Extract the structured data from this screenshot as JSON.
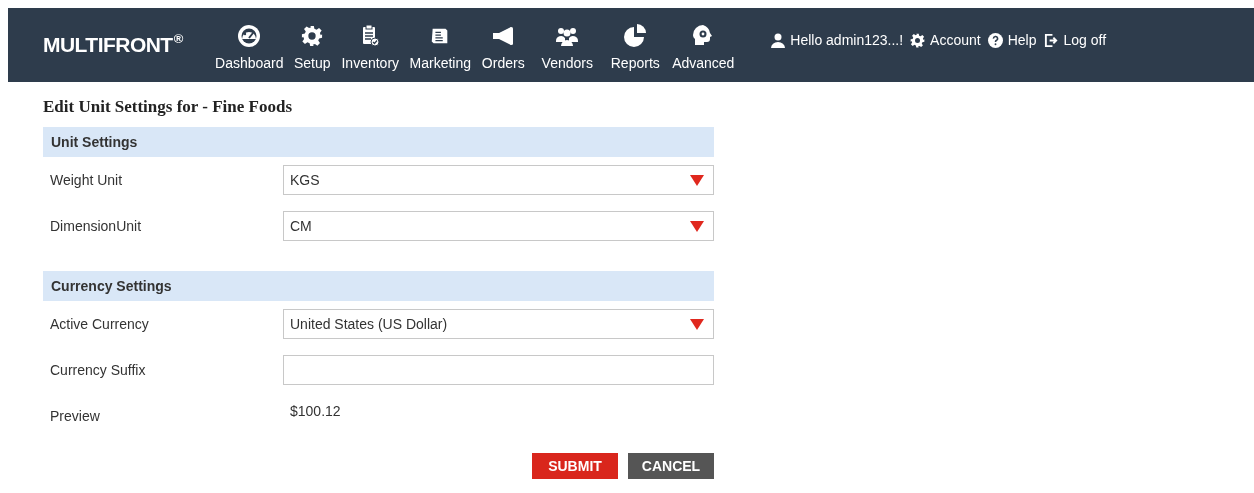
{
  "header": {
    "logo": "MULTIFRONT",
    "logo_mark": "®",
    "nav": [
      {
        "label": "Dashboard"
      },
      {
        "label": "Setup"
      },
      {
        "label": "Inventory"
      },
      {
        "label": "Marketing"
      },
      {
        "label": "Orders"
      },
      {
        "label": "Vendors"
      },
      {
        "label": "Reports"
      },
      {
        "label": "Advanced"
      }
    ],
    "user_links": [
      {
        "label": "Hello admin123...!"
      },
      {
        "label": "Account"
      },
      {
        "label": "Help"
      },
      {
        "label": "Log off"
      }
    ]
  },
  "page_title": "Edit Unit Settings for - Fine Foods",
  "sections": [
    {
      "title": "Unit Settings",
      "rows": [
        {
          "kind": "select",
          "label": "Weight Unit",
          "value": "KGS"
        },
        {
          "kind": "select",
          "label": "DimensionUnit",
          "value": "CM"
        }
      ]
    },
    {
      "title": "Currency Settings",
      "rows": [
        {
          "kind": "select",
          "label": "Active Currency",
          "value": "United States (US Dollar)"
        },
        {
          "kind": "text",
          "label": "Currency Suffix"
        },
        {
          "kind": "static",
          "label": "Preview",
          "value": "$100.12"
        }
      ]
    }
  ],
  "buttons": [
    {
      "kind": "primary",
      "label": "SUBMIT"
    },
    {
      "kind": "secondary",
      "label": "CANCEL"
    }
  ]
}
